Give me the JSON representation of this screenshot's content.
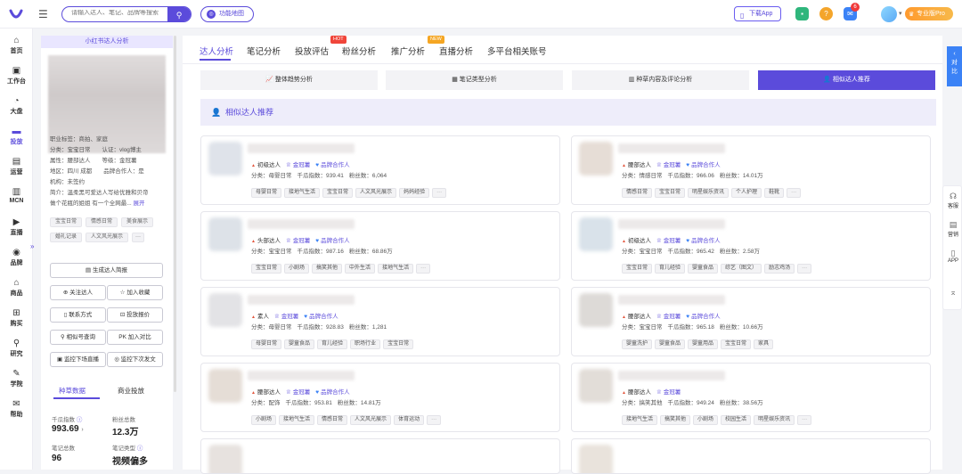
{
  "topbar": {
    "search_placeholder": "请输入达人、笔记、品牌等搜索",
    "map_button": "功能地图",
    "download_app": "下载App",
    "notif_count": "6",
    "pro_label": "专业版Pro"
  },
  "leftnav": [
    {
      "label": "首页",
      "icon": "home-icon",
      "glyph": "⌂",
      "active": false
    },
    {
      "label": "工作台",
      "icon": "workbench-icon",
      "glyph": "▣",
      "active": false
    },
    {
      "label": "大盘",
      "icon": "market-icon",
      "glyph": "◔",
      "active": false
    },
    {
      "label": "投放",
      "icon": "folder-icon",
      "glyph": "▬",
      "active": true
    },
    {
      "label": "运营",
      "icon": "ops-icon",
      "glyph": "▤",
      "active": false
    },
    {
      "label": "MCN",
      "icon": "mcn-icon",
      "glyph": "▥",
      "active": false
    },
    {
      "label": "直播",
      "icon": "live-icon",
      "glyph": "▶",
      "active": false
    },
    {
      "label": "品牌",
      "icon": "brand-icon",
      "glyph": "◉",
      "active": false
    },
    {
      "label": "商品",
      "icon": "goods-icon",
      "glyph": "⌂",
      "active": false
    },
    {
      "label": "购买",
      "icon": "cart-icon",
      "glyph": "⊞",
      "active": false
    },
    {
      "label": "研究",
      "icon": "research-icon",
      "glyph": "⚲",
      "active": false
    },
    {
      "label": "学院",
      "icon": "academy-icon",
      "glyph": "✎",
      "active": false
    },
    {
      "label": "帮助",
      "icon": "help-icon",
      "glyph": "✉",
      "active": false
    }
  ],
  "profile": {
    "header": "小红书达人分析",
    "lines": [
      "职业标签：商拍、家庭",
      "分类：宝宝日常　　认证：vlog博主",
      "属性：腰部达人　　等级：金冠薯",
      "地区：四川 成都　　品牌合作人：是",
      "机构：未签约",
      "简介：温柔黑可爱达人写给优雅和贝帝",
      "做个花瓶的姐姐 有一个全网最..."
    ],
    "expand": "展开",
    "chips": [
      "宝宝日常",
      "情感日常",
      "美食展示",
      "婚礼记录",
      "人文风光展示",
      "···"
    ],
    "buttons": [
      "生成达人简报",
      "关注达人",
      "加入收藏",
      "联系方式",
      "投放报价",
      "相似号查询",
      "加入对比",
      "监控下场直播",
      "监控下次发文"
    ],
    "tabs": [
      "种草数据",
      "商业投放"
    ],
    "stats": [
      {
        "label": "千瓜指数",
        "value": "993.69"
      },
      {
        "label": "粉丝总数",
        "value": "12.3万"
      },
      {
        "label": "笔记总数",
        "value": "96"
      },
      {
        "label": "笔记类型",
        "value": "视频偏多"
      }
    ]
  },
  "main": {
    "tabs": [
      "达人分析",
      "笔记分析",
      "投放评估",
      "粉丝分析",
      "推广分析",
      "直播分析",
      "多平台相关账号"
    ],
    "hot_tag": "HOT",
    "new_tag": "NEW",
    "subtabs": [
      "整体趋势分析",
      "笔记类型分析",
      "种草内容及评论分析",
      "相似达人推荐"
    ],
    "section_title": "相似达人推荐",
    "cards": [
      {
        "level": "初级达人",
        "crown": "金冠薯",
        "brand": "品牌合作人",
        "category": "分类：母婴日常",
        "index": "千瓜指数：939.41",
        "fans": "粉丝数：6,064",
        "tags": [
          "母婴日常",
          "接地气生活",
          "宝宝日常",
          "人文风光展示",
          "妈妈经验",
          "···"
        ]
      },
      {
        "level": "腰部达人",
        "crown": "金冠薯",
        "brand": "品牌合作人",
        "category": "分类：情感日常",
        "index": "千瓜指数：966.06",
        "fans": "粉丝数：14.01万",
        "tags": [
          "情感日常",
          "宝宝日常",
          "明星娱乐资讯",
          "个人护理",
          "鞋靴",
          "···"
        ]
      },
      {
        "level": "头部达人",
        "crown": "金冠薯",
        "brand": "品牌合作人",
        "category": "分类：宝宝日常",
        "index": "千瓜指数：987.16",
        "fans": "粉丝数：68.86万",
        "tags": [
          "宝宝日常",
          "小剧场",
          "搞笑其他",
          "中外生活",
          "接地气生活",
          "···"
        ]
      },
      {
        "level": "初级达人",
        "crown": "金冠薯",
        "brand": "品牌合作人",
        "category": "分类：宝宝日常",
        "index": "千瓜指数：965.42",
        "fans": "粉丝数：2.58万",
        "tags": [
          "宝宝日常",
          "育儿经验",
          "婴童食品",
          "综艺（图文）",
          "励志鸡汤",
          "···"
        ]
      },
      {
        "level": "素人",
        "crown": "金冠薯",
        "brand": "品牌合作人",
        "category": "分类：母婴日常",
        "index": "千瓜指数：928.83",
        "fans": "粉丝数：1,281",
        "tags": [
          "母婴日常",
          "婴童食品",
          "育儿经验",
          "职场行业",
          "宝宝日常"
        ]
      },
      {
        "level": "腰部达人",
        "crown": "金冠薯",
        "brand": "品牌合作人",
        "category": "分类：宝宝日常",
        "index": "千瓜指数：965.18",
        "fans": "粉丝数：10.66万",
        "tags": [
          "婴童洗护",
          "婴童食品",
          "婴童用品",
          "宝宝日常",
          "家具"
        ]
      },
      {
        "level": "腰部达人",
        "crown": "金冠薯",
        "brand": "品牌合作人",
        "category": "分类：配饰",
        "index": "千瓜指数：953.81",
        "fans": "粉丝数：14.81万",
        "tags": [
          "小剧场",
          "接地气生活",
          "情感日常",
          "人文风光展示",
          "体育运动",
          "···"
        ]
      },
      {
        "level": "腰部达人",
        "crown": "金冠薯",
        "brand": "",
        "category": "分类：搞笑其他",
        "index": "千瓜指数：949.24",
        "fans": "粉丝数：38.56万",
        "tags": [
          "接地气生活",
          "搞笑其他",
          "小剧场",
          "校园生活",
          "明星娱乐资讯",
          "···"
        ]
      }
    ]
  },
  "right": {
    "contrast": "对比",
    "side": [
      "客服",
      "营销",
      "APP"
    ]
  }
}
